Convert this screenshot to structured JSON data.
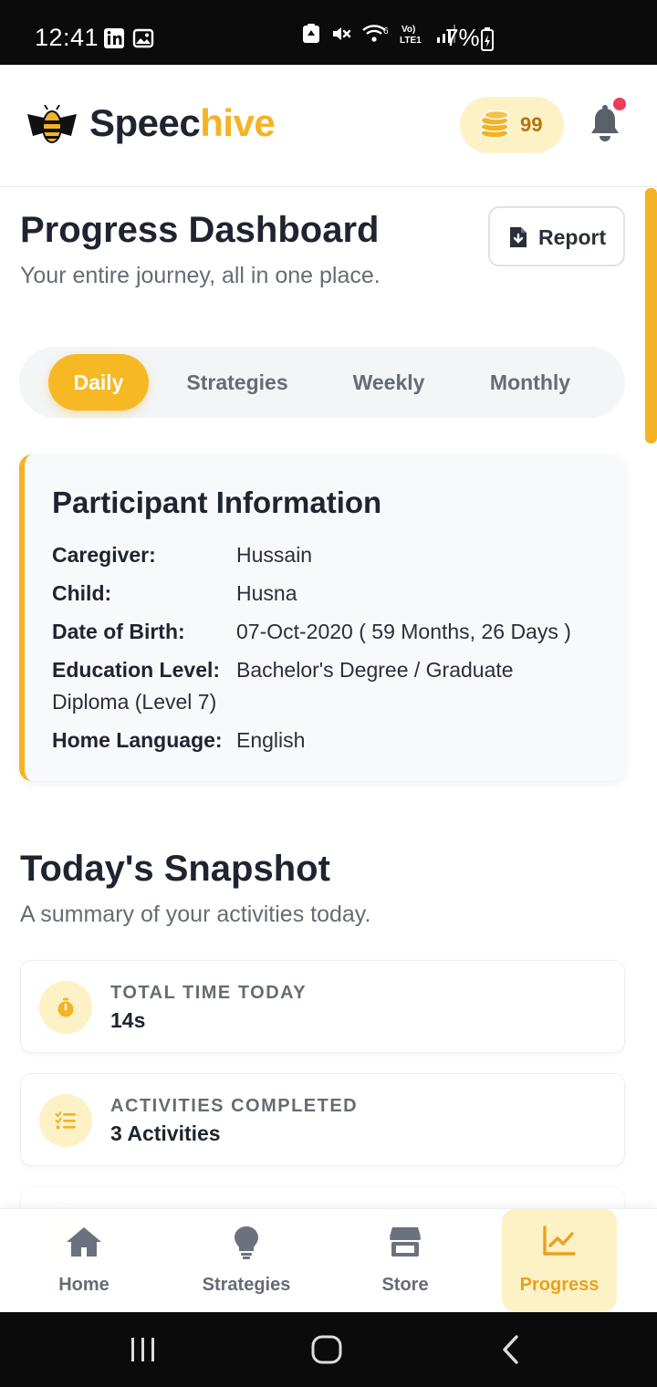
{
  "status_bar": {
    "time": "12:41",
    "battery": "7%",
    "icons": [
      "linkedin-icon",
      "image-icon",
      "recycle-icon",
      "mute-icon",
      "wifi-icon",
      "volte-icon",
      "signal-icon",
      "battery-icon"
    ]
  },
  "header": {
    "brand_part1": "Speec",
    "brand_part2": "hive",
    "coins": "99",
    "accent_color": "#f4b324"
  },
  "page": {
    "title": "Progress Dashboard",
    "subtitle": "Your entire journey, all in one place.",
    "report_label": "Report"
  },
  "tabs": [
    {
      "label": "Daily",
      "active": true
    },
    {
      "label": "Strategies",
      "active": false
    },
    {
      "label": "Weekly",
      "active": false
    },
    {
      "label": "Monthly",
      "active": false
    }
  ],
  "participant": {
    "title": "Participant Information",
    "rows": [
      {
        "label": "Caregiver:",
        "value": "Hussain"
      },
      {
        "label": "Child:",
        "value": "Husna"
      },
      {
        "label": "Date of Birth:",
        "value": "07-Oct-2020 ( 59 Months, 26 Days )"
      },
      {
        "label": "Education Level:",
        "value": "Bachelor's Degree / Graduate",
        "value_cont": "Diploma (Level 7)"
      },
      {
        "label": "Home Language:",
        "value": "English"
      }
    ]
  },
  "snapshot": {
    "title": "Today's Snapshot",
    "subtitle": "A summary of your activities today.",
    "cards": [
      {
        "label": "TOTAL TIME TODAY",
        "value": "14s",
        "icon": "stopwatch-icon"
      },
      {
        "label": "ACTIVITIES COMPLETED",
        "value": "3 Activities",
        "icon": "checklist-icon"
      }
    ]
  },
  "bottom_nav": [
    {
      "label": "Home",
      "icon": "home-icon",
      "active": false
    },
    {
      "label": "Strategies",
      "icon": "lightbulb-icon",
      "active": false
    },
    {
      "label": "Store",
      "icon": "store-icon",
      "active": false
    },
    {
      "label": "Progress",
      "icon": "chart-line-icon",
      "active": true
    }
  ]
}
